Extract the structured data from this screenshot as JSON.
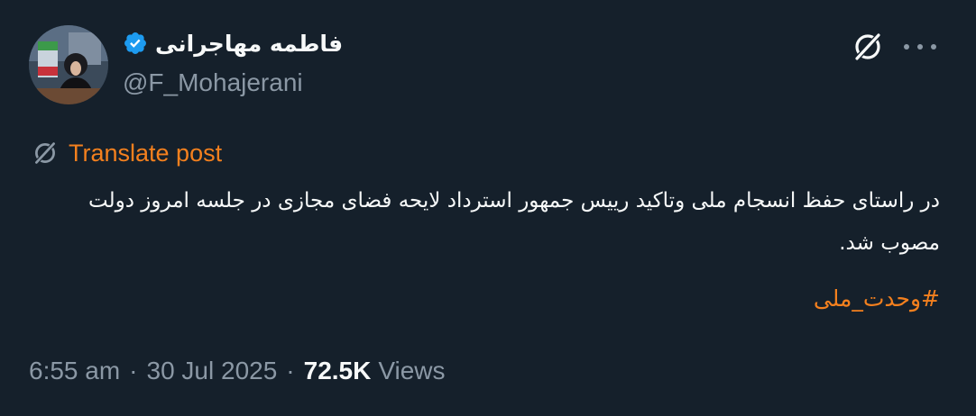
{
  "author": {
    "display_name": "فاطمه مهاجرانی",
    "handle": "@F_Mohajerani",
    "verified": true
  },
  "translate": {
    "label": "Translate post"
  },
  "post": {
    "text": "در راستای حفظ انسجام ملی وتاکید رییس جمهور استرداد لایحه فضای مجازی در جلسه امروز دولت مصوب شد.",
    "hashtag": "#وحدت_ملی"
  },
  "meta": {
    "time": "6:55 am",
    "date": "30 Jul 2025",
    "separator": "·",
    "views_count": "72.5K",
    "views_label": "Views"
  },
  "icons": {
    "verified": "verified-badge-icon",
    "grok": "grok-icon",
    "more": "more-options-icon",
    "translate": "grok-translate-icon"
  },
  "colors": {
    "background": "#15202b",
    "primary_text": "#f7f9f9",
    "secondary_text": "#8b98a5",
    "accent": "#f4801e",
    "verified": "#1d9bf0"
  }
}
